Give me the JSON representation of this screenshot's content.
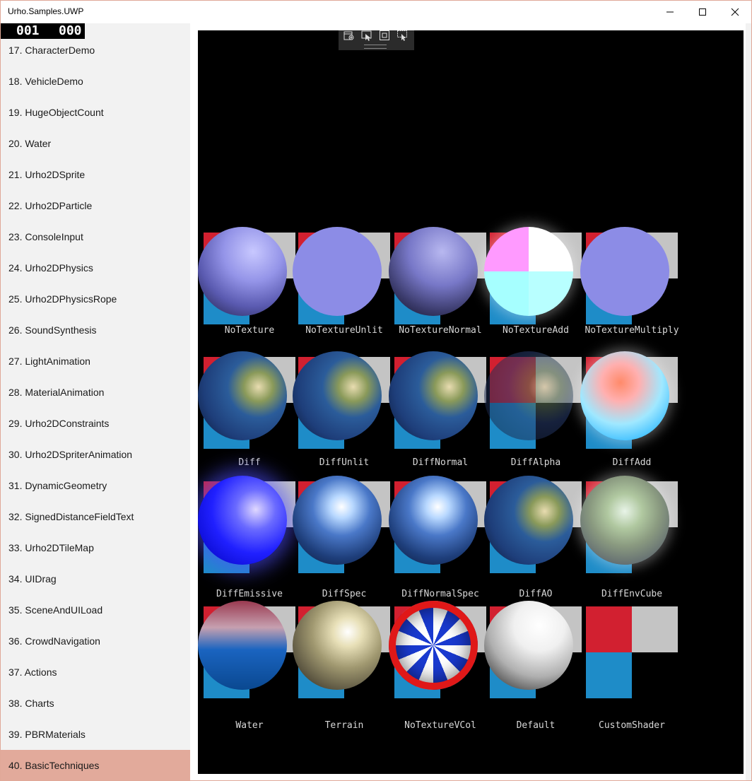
{
  "window": {
    "title": "Urho.Samples.UWP",
    "controls": [
      "minimize",
      "maximize",
      "close"
    ]
  },
  "fps_counter": {
    "left": "001",
    "right": "000"
  },
  "sidebar": {
    "items": [
      {
        "label": "17. CharacterDemo"
      },
      {
        "label": "18. VehicleDemo"
      },
      {
        "label": "19. HugeObjectCount"
      },
      {
        "label": "20. Water"
      },
      {
        "label": "21. Urho2DSprite"
      },
      {
        "label": "22. Urho2DParticle"
      },
      {
        "label": "23. ConsoleInput"
      },
      {
        "label": "24. Urho2DPhysics"
      },
      {
        "label": "25. Urho2DPhysicsRope"
      },
      {
        "label": "26. SoundSynthesis"
      },
      {
        "label": "27. LightAnimation"
      },
      {
        "label": "28. MaterialAnimation"
      },
      {
        "label": "29. Urho2DConstraints"
      },
      {
        "label": "30. Urho2DSpriterAnimation"
      },
      {
        "label": "31. DynamicGeometry"
      },
      {
        "label": "32. SignedDistanceFieldText"
      },
      {
        "label": "33. Urho2DTileMap"
      },
      {
        "label": "34. UIDrag"
      },
      {
        "label": "35. SceneAndUILoad"
      },
      {
        "label": "36. CrowdNavigation"
      },
      {
        "label": "37. Actions"
      },
      {
        "label": "38. Charts"
      },
      {
        "label": "39. PBRMaterials"
      },
      {
        "label": "40. BasicTechniques",
        "selected": true
      }
    ]
  },
  "debug_toolbar": {
    "icons": [
      "select-element-icon",
      "pointer-icon",
      "layout-bounds-icon",
      "track-focus-icon"
    ]
  },
  "techniques": [
    {
      "label": "NoTexture",
      "sphere": "lavender-matte"
    },
    {
      "label": "NoTextureUnlit",
      "sphere": "lavender-flat"
    },
    {
      "label": "NoTextureNormal",
      "sphere": "lavender-bumped"
    },
    {
      "label": "NoTextureAdd",
      "sphere": "additive"
    },
    {
      "label": "NoTextureMultiply",
      "sphere": "lavender-flat"
    },
    {
      "label": "Diff",
      "sphere": "earth"
    },
    {
      "label": "DiffUnlit",
      "sphere": "earth"
    },
    {
      "label": "DiffNormal",
      "sphere": "earth"
    },
    {
      "label": "DiffAlpha",
      "sphere": "earth-translucent"
    },
    {
      "label": "DiffAdd",
      "sphere": "earth-additive"
    },
    {
      "label": "DiffEmissive",
      "sphere": "earth-emissive"
    },
    {
      "label": "DiffSpec",
      "sphere": "earth-specular"
    },
    {
      "label": "DiffNormalSpec",
      "sphere": "earth-specular"
    },
    {
      "label": "DiffAO",
      "sphere": "earth"
    },
    {
      "label": "DiffEnvCube",
      "sphere": "earth-envcube"
    },
    {
      "label": "Water",
      "sphere": "water"
    },
    {
      "label": "Terrain",
      "sphere": "terrain"
    },
    {
      "label": "NoTextureVCol",
      "sphere": "vertex-color"
    },
    {
      "label": "Default",
      "sphere": "white"
    },
    {
      "label": "CustomShader",
      "sphere": "none"
    }
  ],
  "colors": {
    "selected_item": "#e2aa9b",
    "tile_red": "#d22030",
    "tile_grey": "#c4c4c4",
    "tile_blue": "#1e8cc8",
    "viewport_bg": "#000000"
  }
}
